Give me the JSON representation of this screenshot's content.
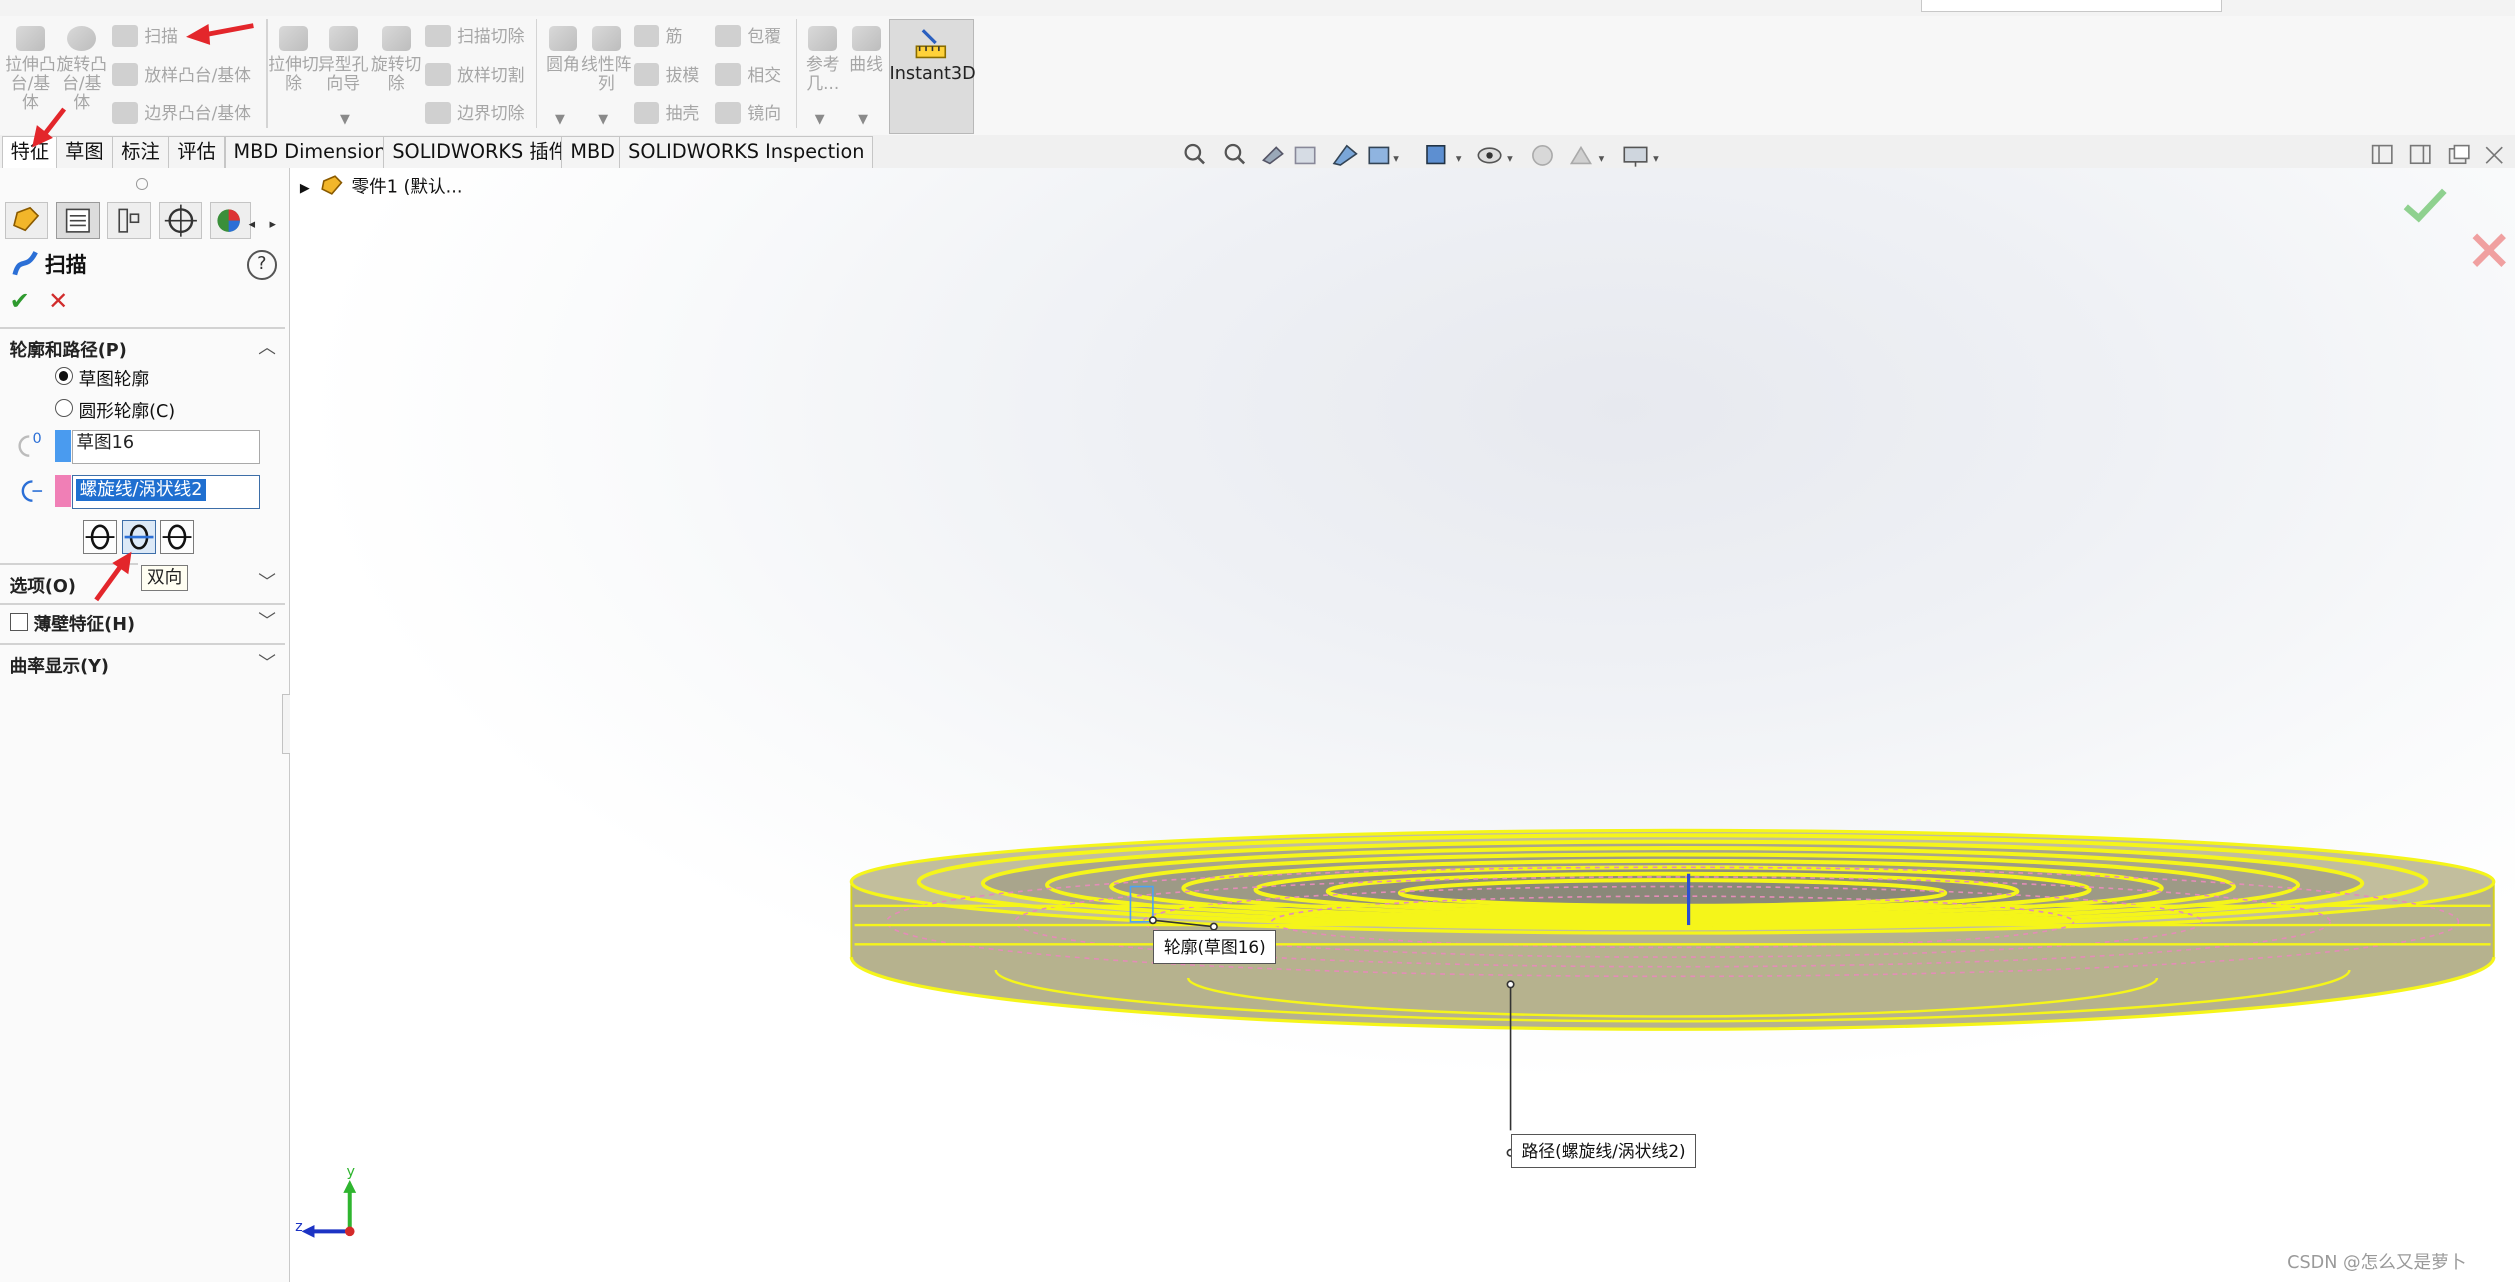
{
  "command_manager": {
    "extrude_boss_label": "拉伸凸台/基体",
    "revolve_boss_label": "旋转凸台/基体",
    "sweep_label": "扫描",
    "loft_label": "放样凸台/基体",
    "boundary_label": "边界凸台/基体",
    "extrude_cut_label": "拉伸切除",
    "hole_wizard_label": "异型孔向导",
    "revolve_cut_label": "旋转切除",
    "swept_cut_label": "扫描切除",
    "lofted_cut_label": "放样切割",
    "boundary_cut_label": "边界切除",
    "fillet_label": "圆角",
    "linear_pattern_label": "线性阵列",
    "rib_label": "筋",
    "draft_label": "拔模",
    "shell_label": "抽壳",
    "wrap_label": "包覆",
    "intersect_label": "相交",
    "mirror_label": "镜向",
    "reference_label": "参考几...",
    "curves_label": "曲线",
    "instant3d_label": "Instant3D"
  },
  "tabs": [
    {
      "label": "特征",
      "active": true
    },
    {
      "label": "草图",
      "active": false
    },
    {
      "label": "标注",
      "active": false
    },
    {
      "label": "评估",
      "active": false
    },
    {
      "label": "MBD Dimensions",
      "active": false
    },
    {
      "label": "SOLIDWORKS 插件",
      "active": false
    },
    {
      "label": "MBD",
      "active": false
    },
    {
      "label": "SOLIDWORKS Inspection",
      "active": false
    }
  ],
  "property_manager": {
    "title": "扫描",
    "help_icon": "?",
    "ok_glyph": "✔",
    "cancel_glyph": "✕",
    "profile_path": {
      "title": "轮廓和路径(P)",
      "sketch_profile_label": "草图轮廓",
      "sketch_profile_selected": true,
      "circular_profile_label": "圆形轮廓(C)",
      "circular_profile_selected": false,
      "profile_value": "草图16",
      "path_value": "螺旋线/涡状线2",
      "profile_color": "#4a9bef",
      "path_color": "#f07fb6"
    },
    "direction_tooltip": "双向",
    "options_title": "选项(O)",
    "thin_feature_title": "薄壁特征(H)",
    "thin_feature_checked": false,
    "curvature_title": "曲率显示(Y)"
  },
  "feature_tree": {
    "item_label": "零件1  (默认..."
  },
  "viewport": {
    "profile_callout": "轮廓(草图16)",
    "path_callout": "路径(螺旋线/涡状线2)",
    "preview_color": "#f5f51a",
    "triad_y": "y",
    "triad_z": "z"
  },
  "watermark": "CSDN @怎么又是萝卜"
}
